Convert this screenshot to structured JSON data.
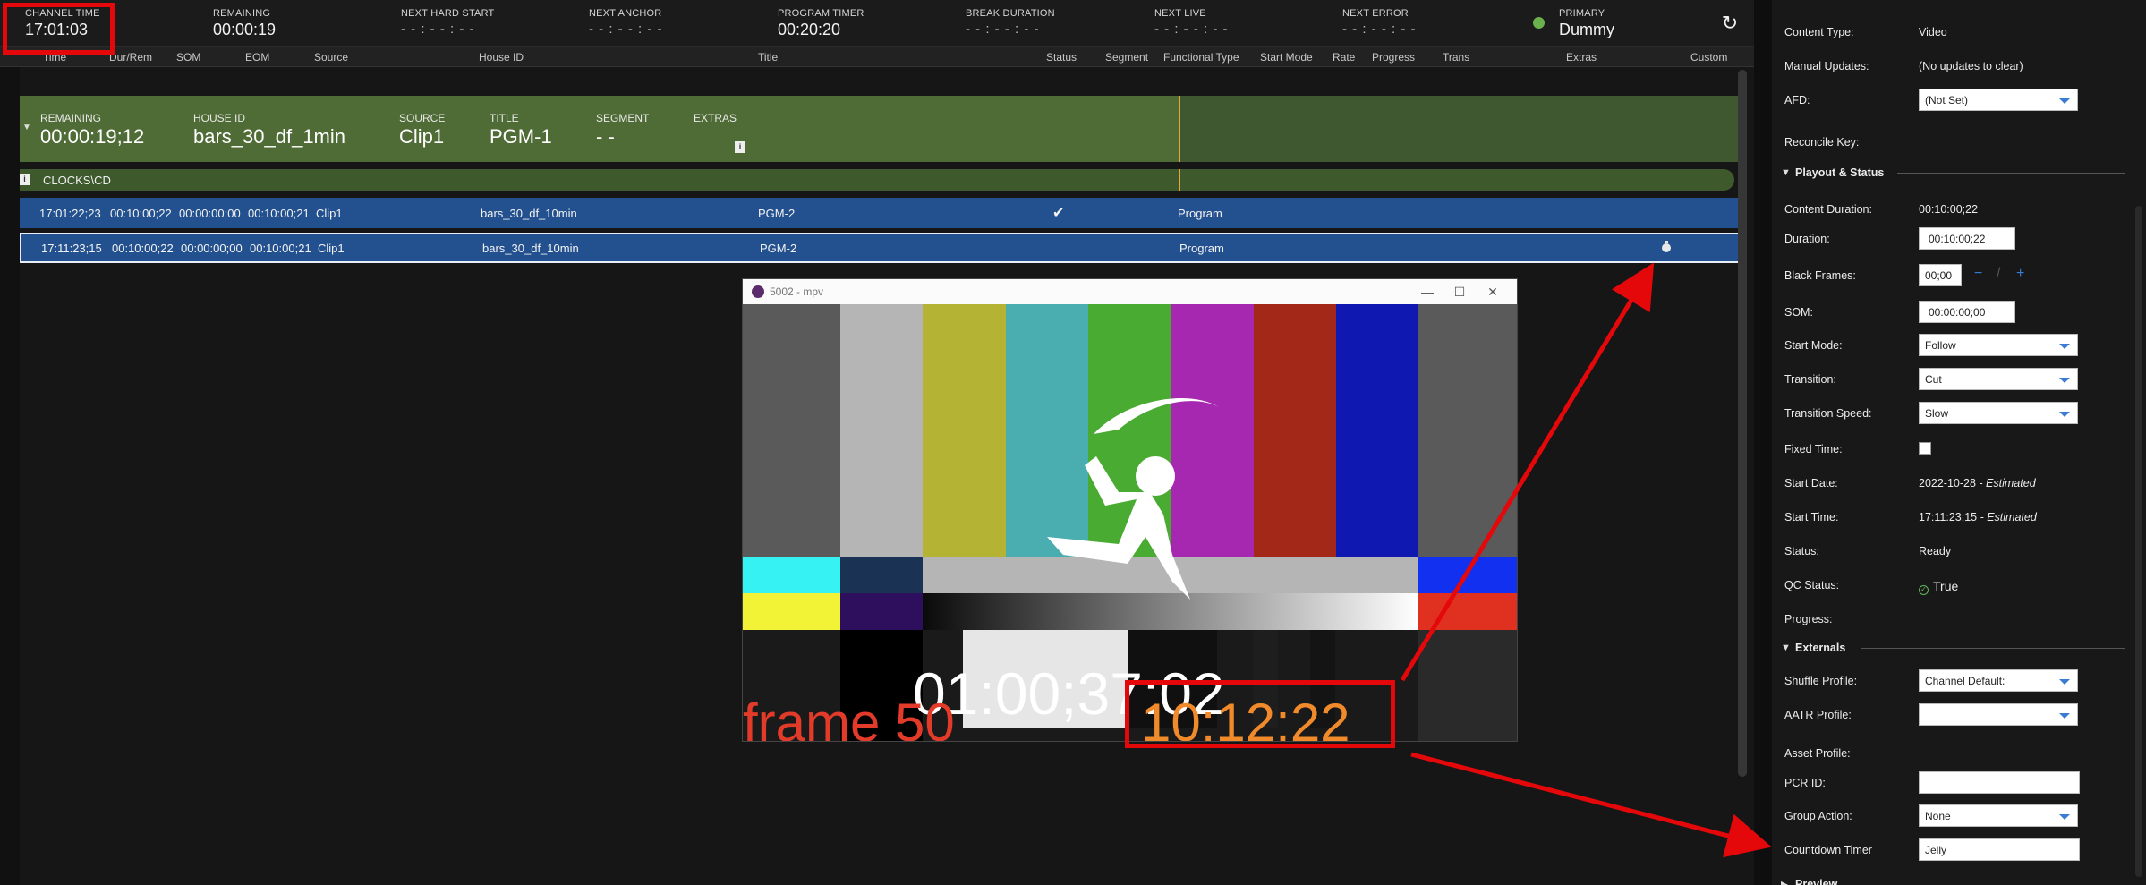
{
  "topbar": {
    "channel_time_label": "CHANNEL TIME",
    "channel_time": "17:01:03",
    "remaining_label": "REMAINING",
    "remaining": "00:00:19",
    "next_hard_start_label": "NEXT HARD START",
    "next_hard_start": "- - : - - : - -",
    "next_anchor_label": "NEXT ANCHOR",
    "next_anchor": "- - : - - : - -",
    "program_timer_label": "PROGRAM TIMER",
    "program_timer": "00:20:20",
    "break_duration_label": "BREAK DURATION",
    "break_duration": "- - : - - : - -",
    "next_live_label": "NEXT LIVE",
    "next_live": "- - : - - : - -",
    "next_error_label": "NEXT ERROR",
    "next_error": "- - : - - : - -",
    "primary_label": "PRIMARY",
    "primary_value": "Dummy"
  },
  "columns": [
    "Time",
    "Dur/Rem",
    "SOM",
    "EOM",
    "Source",
    "House ID",
    "Title",
    "Status",
    "Segment",
    "Functional Type",
    "Start Mode",
    "Rate",
    "Progress",
    "Trans",
    "Extras",
    "Custom"
  ],
  "current_block": {
    "remaining_label": "REMAINING",
    "remaining": "00:00:19;12",
    "house_id_label": "HOUSE ID",
    "house_id": "bars_30_df_1min",
    "source_label": "SOURCE",
    "source": "Clip1",
    "title_label": "TITLE",
    "title": "PGM-1",
    "segment_label": "SEGMENT",
    "segment": "- -",
    "extras_label": "EXTRAS"
  },
  "clocks_label": "CLOCKS\\CD",
  "rows": [
    {
      "time": "17:01:22;23",
      "dur": "00:10:00;22",
      "som": "00:00:00;00",
      "eom": "00:10:00;21",
      "source": "Clip1",
      "house_id": "bars_30_df_10min",
      "title": "PGM-2",
      "status": "✔",
      "functional_type": "Program"
    },
    {
      "time": "17:11:23;15",
      "dur": "00:10:00;22",
      "som": "00:00:00;00",
      "eom": "00:10:00;21",
      "source": "Clip1",
      "house_id": "bars_30_df_10min",
      "title": "PGM-2",
      "status": "",
      "functional_type": "Program"
    }
  ],
  "mpv": {
    "title": "5002 - mpv",
    "minimize": "—",
    "maximize": "☐",
    "close": "✕",
    "timecode": "01:00;37:02",
    "frame_text": "frame 50",
    "countdown": "10:12:22"
  },
  "props": {
    "content_type_label": "Content Type:",
    "content_type": "Video",
    "manual_updates_label": "Manual Updates:",
    "manual_updates": "(No updates to clear)",
    "afd_label": "AFD:",
    "afd": "(Not Set)",
    "reconcile_key_label": "Reconcile Key:",
    "playout_section": "Playout & Status",
    "content_duration_label": "Content Duration:",
    "content_duration": "00:10:00;22",
    "duration_label": "Duration:",
    "duration": "00:10:00;22",
    "black_frames_label": "Black Frames:",
    "black_frames": "00;00",
    "black_minus": "−",
    "black_sep": "/",
    "black_plus": "+",
    "som_label": "SOM:",
    "som": "00:00:00;00",
    "start_mode_label": "Start Mode:",
    "start_mode": "Follow",
    "transition_label": "Transition:",
    "transition": "Cut",
    "transition_speed_label": "Transition Speed:",
    "transition_speed": "Slow",
    "fixed_time_label": "Fixed Time:",
    "start_date_label": "Start Date:",
    "start_date": "2022-10-28",
    "start_date_note": " - Estimated",
    "start_time_label": "Start Time:",
    "start_time": "17:11:23;15",
    "start_time_note": " - Estimated",
    "status_label": "Status:",
    "status": "Ready",
    "qc_status_label": "QC Status:",
    "qc_status": "True",
    "progress_label": "Progress:",
    "externals_section": "Externals",
    "shuffle_profile_label": "Shuffle Profile:",
    "shuffle_profile": "Channel Default:",
    "aatr_profile_label": "AATR Profile:",
    "aatr_profile": "",
    "asset_profile_label": "Asset Profile:",
    "pcr_id_label": "PCR ID:",
    "pcr_id": "",
    "group_action_label": "Group Action:",
    "group_action": "None",
    "countdown_timer_label": "Countdown Timer",
    "countdown_timer": "Jelly",
    "preview_section": "Preview"
  },
  "colors": {
    "accent": "#3a7bd5",
    "row_blue": "#23518f",
    "block_green": "#506c36",
    "annotation_red": "#e4080a"
  }
}
